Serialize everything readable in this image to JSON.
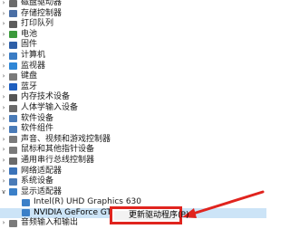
{
  "tree": {
    "items": [
      {
        "label": "磁盘驱动器",
        "icon": "disk-drive-icon",
        "color": "#6b6b6b",
        "state": "collapsed",
        "indent": 0
      },
      {
        "label": "存储控制器",
        "icon": "storage-controller-icon",
        "color": "#4a6fa5",
        "state": "collapsed",
        "indent": 0
      },
      {
        "label": "打印队列",
        "icon": "printer-icon",
        "color": "#5c5c5c",
        "state": "collapsed",
        "indent": 0
      },
      {
        "label": "电池",
        "icon": "battery-icon",
        "color": "#3c9a3c",
        "state": "collapsed",
        "indent": 0
      },
      {
        "label": "固件",
        "icon": "firmware-icon",
        "color": "#2e5fa7",
        "state": "collapsed",
        "indent": 0
      },
      {
        "label": "计算机",
        "icon": "computer-icon",
        "color": "#3a7cc4",
        "state": "collapsed",
        "indent": 0
      },
      {
        "label": "监视器",
        "icon": "monitor-icon",
        "color": "#2f86d6",
        "state": "collapsed",
        "indent": 0
      },
      {
        "label": "键盘",
        "icon": "keyboard-icon",
        "color": "#7a7a7a",
        "state": "collapsed",
        "indent": 0
      },
      {
        "label": "蓝牙",
        "icon": "bluetooth-icon",
        "color": "#1f5fbf",
        "state": "collapsed",
        "indent": 0
      },
      {
        "label": "内存技术设备",
        "icon": "memory-device-icon",
        "color": "#555555",
        "state": "collapsed",
        "indent": 0
      },
      {
        "label": "人体学输入设备",
        "icon": "hid-icon",
        "color": "#6a6a6a",
        "state": "collapsed",
        "indent": 0
      },
      {
        "label": "软件设备",
        "icon": "software-device-icon",
        "color": "#4a7bb7",
        "state": "collapsed",
        "indent": 0
      },
      {
        "label": "软件组件",
        "icon": "software-component-icon",
        "color": "#4a7bb7",
        "state": "collapsed",
        "indent": 0
      },
      {
        "label": "声音、视频和游戏控制器",
        "icon": "sound-icon",
        "color": "#7a7a7a",
        "state": "collapsed",
        "indent": 0
      },
      {
        "label": "鼠标和其他指针设备",
        "icon": "mouse-icon",
        "color": "#7a7a7a",
        "state": "collapsed",
        "indent": 0
      },
      {
        "label": "通用串行总线控制器",
        "icon": "usb-icon",
        "color": "#6a6a6a",
        "state": "collapsed",
        "indent": 0
      },
      {
        "label": "网络适配器",
        "icon": "network-adapter-icon",
        "color": "#3b73b9",
        "state": "collapsed",
        "indent": 0
      },
      {
        "label": "系统设备",
        "icon": "system-device-icon",
        "color": "#4a7bb7",
        "state": "collapsed",
        "indent": 0
      },
      {
        "label": "显示适配器",
        "icon": "display-adapter-icon",
        "color": "#3b80c8",
        "state": "expanded",
        "indent": 0
      },
      {
        "label": "Intel(R) UHD Graphics 630",
        "icon": "display-adapter-icon",
        "color": "#3b80c8",
        "state": "leaf",
        "indent": 1
      },
      {
        "label": "NVIDIA GeForce GT",
        "icon": "display-adapter-icon",
        "color": "#3b80c8",
        "state": "leaf",
        "indent": 1,
        "selected": true
      },
      {
        "label": "音频输入和输出",
        "icon": "audio-io-icon",
        "color": "#7a7a7a",
        "state": "collapsed",
        "indent": 0
      }
    ]
  },
  "context_menu": {
    "items": [
      {
        "label": "更新驱动程序(P)"
      }
    ]
  },
  "colors": {
    "highlight": "#cce4f7",
    "annotation_red": "#e0241e"
  }
}
